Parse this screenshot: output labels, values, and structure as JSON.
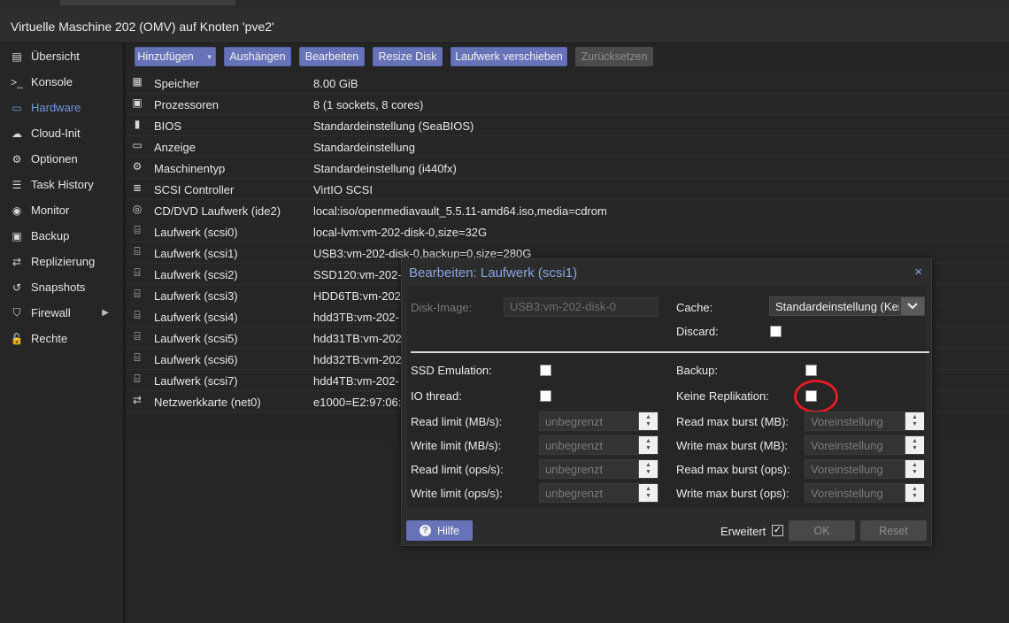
{
  "title": "Virtuelle Maschine 202 (OMV) auf Knoten 'pve2'",
  "sidebar": {
    "items": [
      {
        "label": "Übersicht",
        "icon": "book-icon",
        "glyph": "▤"
      },
      {
        "label": "Konsole",
        "icon": "terminal-icon",
        "glyph": ">_"
      },
      {
        "label": "Hardware",
        "icon": "monitor-icon",
        "glyph": "▭"
      },
      {
        "label": "Cloud-Init",
        "icon": "cloud-icon",
        "glyph": "☁"
      },
      {
        "label": "Optionen",
        "icon": "gear-icon",
        "glyph": "⚙"
      },
      {
        "label": "Task History",
        "icon": "list-icon",
        "glyph": "☰"
      },
      {
        "label": "Monitor",
        "icon": "eye-icon",
        "glyph": "◉"
      },
      {
        "label": "Backup",
        "icon": "floppy-icon",
        "glyph": "▣"
      },
      {
        "label": "Replizierung",
        "icon": "retweet-icon",
        "glyph": "⇄"
      },
      {
        "label": "Snapshots",
        "icon": "history-icon",
        "glyph": "↺"
      },
      {
        "label": "Firewall",
        "icon": "shield-icon",
        "glyph": "⛉"
      },
      {
        "label": "Rechte",
        "icon": "unlock-icon",
        "glyph": "🔓"
      }
    ],
    "firewall_arrow": "▶"
  },
  "toolbar": {
    "add": "Hinzufügen",
    "add_caret": "▼",
    "detach": "Aushängen",
    "edit": "Bearbeiten",
    "resize": "Resize Disk",
    "move": "Laufwerk verschieben",
    "revert": "Zurücksetzen"
  },
  "hardware": [
    {
      "key": "Speicher",
      "value": "8.00 GiB",
      "icon": "memory-icon",
      "glyph": "▦"
    },
    {
      "key": "Prozessoren",
      "value": "8 (1 sockets, 8 cores)",
      "icon": "cpu-icon",
      "glyph": "▣"
    },
    {
      "key": "BIOS",
      "value": "Standardeinstellung (SeaBIOS)",
      "icon": "microchip-icon",
      "glyph": "▮"
    },
    {
      "key": "Anzeige",
      "value": "Standardeinstellung",
      "icon": "desktop-icon",
      "glyph": "▭"
    },
    {
      "key": "Maschinentyp",
      "value": "Standardeinstellung (i440fx)",
      "icon": "cogs-icon",
      "glyph": "⚙"
    },
    {
      "key": "SCSI Controller",
      "value": "VirtIO SCSI",
      "icon": "database-icon",
      "glyph": "≣"
    },
    {
      "key": "CD/DVD Laufwerk (ide2)",
      "value": "local:iso/openmediavault_5.5.11-amd64.iso,media=cdrom",
      "icon": "cdrom-icon",
      "glyph": "◎"
    },
    {
      "key": "Laufwerk (scsi0)",
      "value": "local-lvm:vm-202-disk-0,size=32G",
      "icon": "hdd-icon",
      "glyph": "⌸"
    },
    {
      "key": "Laufwerk (scsi1)",
      "value": "USB3:vm-202-disk-0,backup=0,size=280G",
      "icon": "hdd-icon",
      "glyph": "⌸"
    },
    {
      "key": "Laufwerk (scsi2)",
      "value": "SSD120:vm-202-",
      "icon": "hdd-icon",
      "glyph": "⌸"
    },
    {
      "key": "Laufwerk (scsi3)",
      "value": "HDD6TB:vm-202-",
      "icon": "hdd-icon",
      "glyph": "⌸"
    },
    {
      "key": "Laufwerk (scsi4)",
      "value": "hdd3TB:vm-202-",
      "icon": "hdd-icon",
      "glyph": "⌸"
    },
    {
      "key": "Laufwerk (scsi5)",
      "value": "hdd31TB:vm-202-",
      "icon": "hdd-icon",
      "glyph": "⌸"
    },
    {
      "key": "Laufwerk (scsi6)",
      "value": "hdd32TB:vm-202-",
      "icon": "hdd-icon",
      "glyph": "⌸"
    },
    {
      "key": "Laufwerk (scsi7)",
      "value": "hdd4TB:vm-202-",
      "icon": "hdd-icon",
      "glyph": "⌸"
    },
    {
      "key": "Netzwerkkarte (net0)",
      "value": "e1000=E2:97:06:",
      "icon": "exchange-icon",
      "glyph": "⇄"
    }
  ],
  "dialog": {
    "title": "Bearbeiten: Laufwerk (scsi1)",
    "close": "×",
    "disk_image_label": "Disk-Image:",
    "disk_image_value": "USB3:vm-202-disk-0",
    "cache_label": "Cache:",
    "cache_value": "Standardeinstellung (Kei",
    "discard_label": "Discard:",
    "ssd_label": "SSD Emulation:",
    "backup_label": "Backup:",
    "iothread_label": "IO thread:",
    "norepl_label": "Keine Replikation:",
    "read_limit_label": "Read limit (MB/s):",
    "write_limit_label": "Write limit (MB/s):",
    "read_ops_label": "Read limit (ops/s):",
    "write_ops_label": "Write limit (ops/s):",
    "read_burst_label": "Read max burst (MB):",
    "write_burst_label": "Write max burst (MB):",
    "read_burst_ops_label": "Read max burst (ops):",
    "write_burst_ops_label": "Write max burst (ops):",
    "unlimited_placeholder": "unbegrenzt",
    "default_placeholder": "Voreinstellung",
    "help": "Hilfe",
    "help_glyph": "?",
    "advanced_label": "Erweitert",
    "advanced_check": "✓",
    "ok": "OK",
    "reset": "Reset",
    "spin_up": "▲",
    "spin_down": "▼",
    "combo_arrow": "⌄",
    "highlight_color": "#e01b22"
  }
}
